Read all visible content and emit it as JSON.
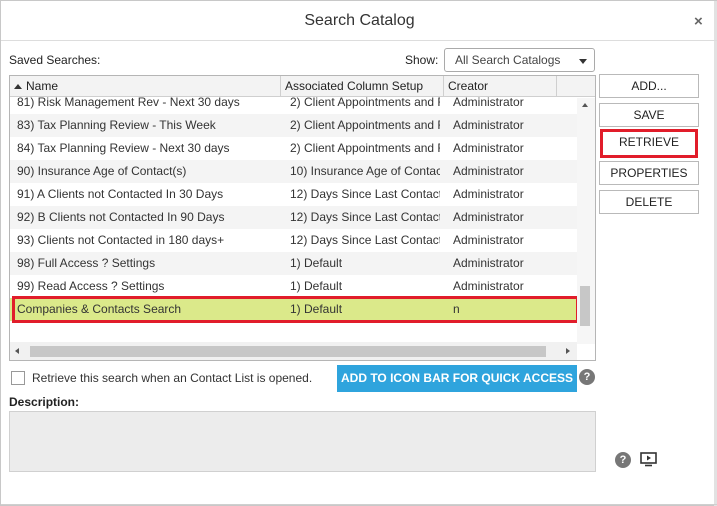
{
  "dialog": {
    "title": "Search Catalog",
    "close_glyph": "×"
  },
  "saved_label": "Saved Searches:",
  "show": {
    "label": "Show:",
    "value": "All Search Catalogs"
  },
  "grid": {
    "columns": [
      "Name",
      "Associated Column Setup",
      "Creator"
    ],
    "rows": [
      {
        "name": "81) Risk Management Rev - Next 30 days",
        "setup": "2) Client Appointments and R",
        "creator": "Administrator"
      },
      {
        "name": "83) Tax Planning Review - This Week",
        "setup": "2) Client Appointments and R",
        "creator": "Administrator"
      },
      {
        "name": "84) Tax Planning Review - Next 30 days",
        "setup": "2) Client Appointments and R",
        "creator": "Administrator"
      },
      {
        "name": "90) Insurance Age of Contact(s)",
        "setup": "10) Insurance Age of Contac",
        "creator": "Administrator"
      },
      {
        "name": "91) A Clients not Contacted In 30 Days",
        "setup": "12) Days Since Last Contact",
        "creator": "Administrator"
      },
      {
        "name": "92) B Clients not Contacted In 90 Days",
        "setup": "12) Days Since Last Contact",
        "creator": "Administrator"
      },
      {
        "name": "93) Clients not Contacted in 180 days+",
        "setup": "12) Days Since Last Contact",
        "creator": "Administrator"
      },
      {
        "name": "98) Full Access ? Settings",
        "setup": "1) Default",
        "creator": "Administrator"
      },
      {
        "name": "99) Read Access ? Settings",
        "setup": "1) Default",
        "creator": "Administrator"
      },
      {
        "name": "Companies & Contacts Search",
        "setup": "1) Default",
        "creator": "n"
      }
    ]
  },
  "buttons": {
    "add": "ADD...",
    "save": "SAVE",
    "retrieve": "RETRIEVE",
    "properties": "PROPERTIES",
    "delete": "DELETE"
  },
  "retrieve_checkbox_label": "Retrieve this search when an Contact List is opened.",
  "add_icon_bar": "ADD TO ICON BAR FOR QUICK ACCESS",
  "description_label": "Description:",
  "help_glyph": "?",
  "colors": {
    "selected_row": "#dbe98a",
    "highlight": "#e11d2a",
    "accent": "#2fa4dd"
  },
  "icons": [
    "close-icon",
    "chevron-down-icon",
    "sort-up-icon",
    "help-icon",
    "video-icon"
  ]
}
